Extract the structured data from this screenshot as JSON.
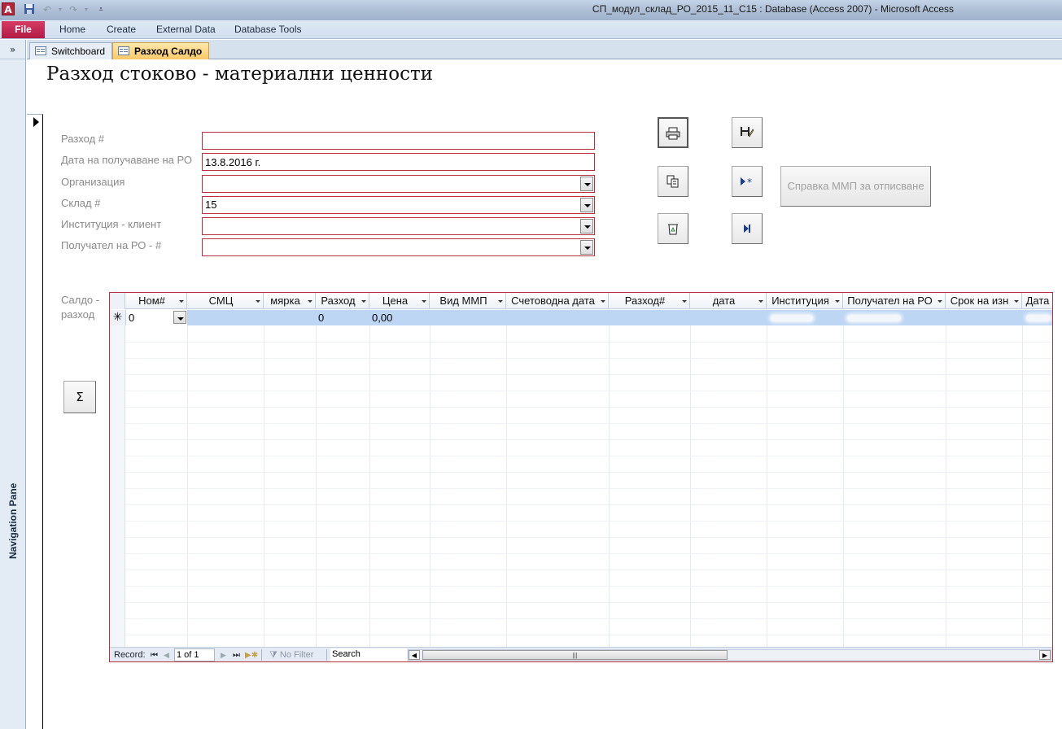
{
  "window": {
    "title": "СП_модул_склад_РО_2015_11_С15 : Database (Access 2007)  -  Microsoft Access",
    "app_icon_letter": "A"
  },
  "ribbon": {
    "file_label": "File",
    "tabs": [
      "Home",
      "Create",
      "External Data",
      "Database Tools"
    ]
  },
  "nav_pane": {
    "toggle": "»",
    "label": "Navigation Pane"
  },
  "doc_tabs": [
    {
      "label": "Switchboard",
      "active": false
    },
    {
      "label": "Разход Салдо",
      "active": true
    }
  ],
  "form": {
    "title": "Разход  стоково - материални ценности",
    "fields": {
      "razhod_num": {
        "label": "Разход #",
        "value": ""
      },
      "date": {
        "label": "Дата на получаване на РО",
        "value": "13.8.2016 г."
      },
      "organization": {
        "label": "Организация",
        "value": ""
      },
      "warehouse": {
        "label": "Склад #",
        "value": "15"
      },
      "institution": {
        "label": "Институция - клиент",
        "value": ""
      },
      "recipient": {
        "label": "Получател на РО - #",
        "value": ""
      }
    },
    "buttons": {
      "report_label": "Справка ММП за отписване",
      "sum_label": "Σ"
    },
    "subform_label": "Салдо - разход"
  },
  "datasheet": {
    "columns": [
      "Ном#",
      "СМЦ",
      "мярка",
      "Разход",
      "Цена",
      "Вид ММП",
      "Счетоводна дата",
      "Разход#",
      "дата",
      "Институция",
      "Получател на РО",
      "Срок на изн",
      "Дата"
    ],
    "new_row": {
      "marker": "✳",
      "nom": "0",
      "razhod": "0",
      "cena": "0,00"
    },
    "navbar": {
      "record_label": "Record:",
      "position": "1 of 1",
      "filter_label": "No Filter",
      "search_placeholder": "Search"
    }
  },
  "colors": {
    "field_border": "#b5323e",
    "active_tab": "#f9c969",
    "file_tab": "#c62a55",
    "new_row_highlight": "#bcd6f4"
  }
}
